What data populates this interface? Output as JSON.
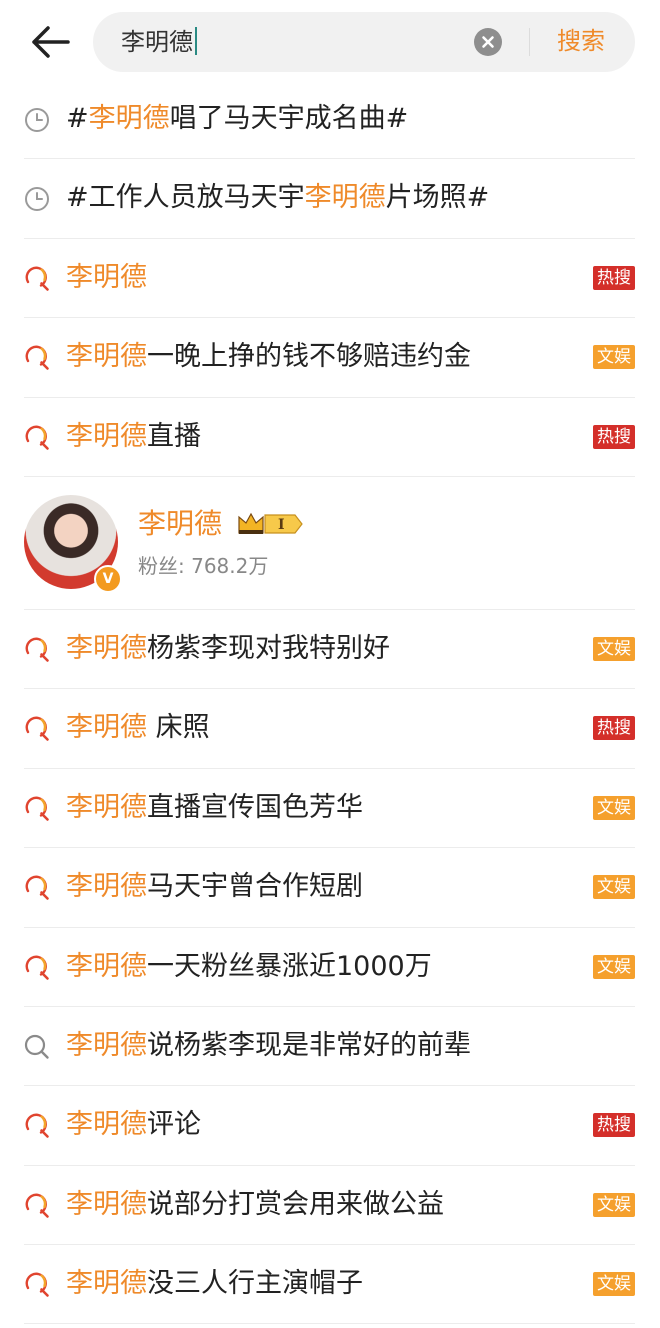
{
  "search": {
    "query": "李明德",
    "button_label": "搜索"
  },
  "colors": {
    "highlight": "#ef8a2a",
    "hot_badge": "#d42f2a",
    "ent_badge": "#f5a02d"
  },
  "history": [
    {
      "pre": "#",
      "hl": "李明德",
      "post": "唱了马天宇成名曲#"
    },
    {
      "pre": "#工作人员放马天宇",
      "hl": "李明德",
      "post": "片场照#"
    }
  ],
  "suggestions_a": [
    {
      "hl": "李明德",
      "post": "",
      "badge": "热搜",
      "type": "hot"
    },
    {
      "hl": "李明德",
      "post": "一晚上挣的钱不够赔违约金",
      "badge": "文娱",
      "type": "ent"
    },
    {
      "hl": "李明德",
      "post": "直播",
      "badge": "热搜",
      "type": "hot"
    }
  ],
  "user": {
    "name": "李明德",
    "fans": "粉丝: 768.2万",
    "level": "I",
    "verified": "V"
  },
  "suggestions_b": [
    {
      "hl": "李明德",
      "post": "杨紫李现对我特别好",
      "badge": "文娱",
      "type": "ent",
      "icon": "colored"
    },
    {
      "hl": "李明德",
      "post": " 床照",
      "badge": "热搜",
      "type": "hot",
      "icon": "colored"
    },
    {
      "hl": "李明德",
      "post": "直播宣传国色芳华",
      "badge": "文娱",
      "type": "ent",
      "icon": "colored"
    },
    {
      "hl": "李明德",
      "post": "马天宇曾合作短剧",
      "badge": "文娱",
      "type": "ent",
      "icon": "colored"
    },
    {
      "hl": "李明德",
      "post": "一天粉丝暴涨近1000万",
      "badge": "文娱",
      "type": "ent",
      "icon": "colored"
    },
    {
      "hl": "李明德",
      "post": "说杨紫李现是非常好的前辈",
      "badge": "",
      "type": "",
      "icon": "gray"
    },
    {
      "hl": "李明德",
      "post": "评论",
      "badge": "热搜",
      "type": "hot",
      "icon": "colored"
    },
    {
      "hl": "李明德",
      "post": "说部分打赏会用来做公益",
      "badge": "文娱",
      "type": "ent",
      "icon": "colored"
    },
    {
      "hl": "李明德",
      "post": "没三人行主演帽子",
      "badge": "文娱",
      "type": "ent",
      "icon": "colored"
    }
  ]
}
